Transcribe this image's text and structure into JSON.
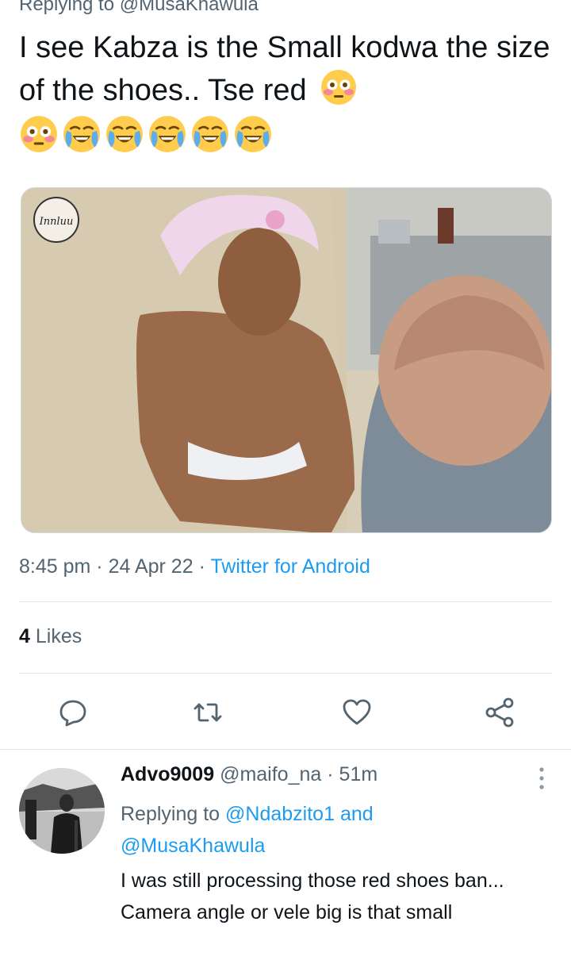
{
  "tweet": {
    "replying_prefix": "Replying to ",
    "replying_handle": "@MusaKhawula",
    "text": "I see Kabza is the Small kodwa the size of the shoes.. Tse red",
    "emoji": [
      "flushed-face",
      "flushed-face",
      "loudly-crying-face",
      "loudly-crying-face",
      "loudly-crying-face",
      "loudly-crying-face",
      "loudly-crying-face"
    ],
    "media_watermark": "Innluu",
    "time": "8:45 pm",
    "date": "24 Apr 22",
    "source": "Twitter for Android",
    "separator": "·",
    "likes_count": "4",
    "likes_label": "Likes"
  },
  "actions": {
    "reply": "reply-icon",
    "retweet": "retweet-icon",
    "like": "heart-icon",
    "share": "share-icon"
  },
  "reply": {
    "name": "Advo9009",
    "handle": "@maifo_na",
    "separator": "·",
    "time": "51m",
    "replying_prefix": "Replying to",
    "mention1": "@Ndabzito1",
    "and": "and",
    "mention2": "@MusaKhawula",
    "text": "I was still processing those red shoes ban... Camera angle or vele big is that small"
  },
  "colors": {
    "text": "#0f1419",
    "secondary": "#536471",
    "accent": "#1d9bf0",
    "divider": "#e1e6ea"
  }
}
